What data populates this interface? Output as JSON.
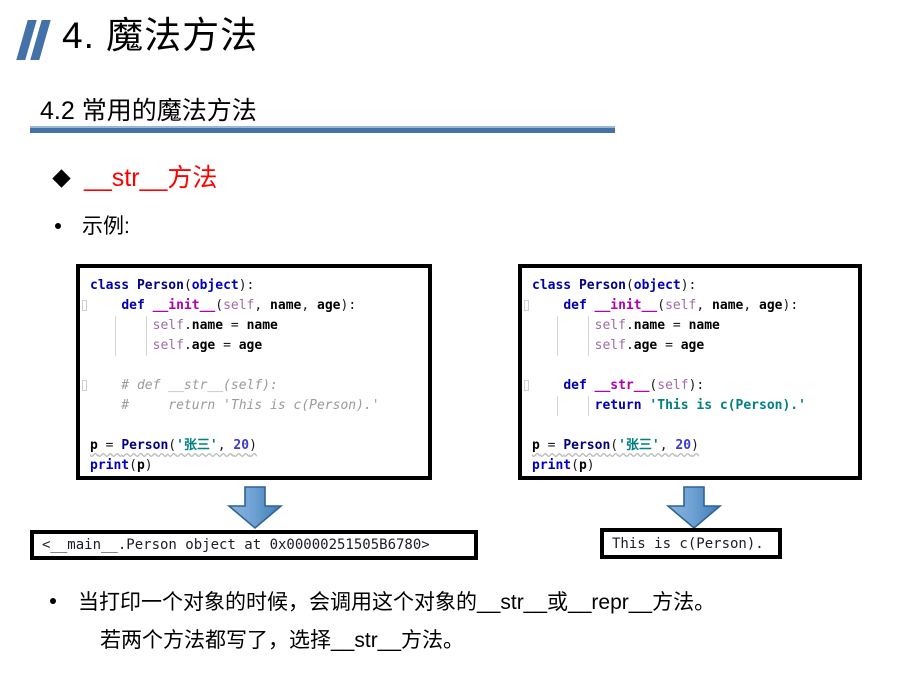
{
  "slide": {
    "title": "4.  魔法方法",
    "section_heading": "4.2  常用的魔法方法",
    "accent_color": "#4472a8",
    "highlight_color": "#ff0000"
  },
  "bullets": {
    "str_method": "__str__方法",
    "example_label": "示例:"
  },
  "icons": {
    "title_mark": "double-slash-mark",
    "diamond_bullet": "diamond-bullet-icon",
    "round_bullet": "round-bullet-icon",
    "arrow": "arrow-down-icon"
  },
  "code_left": {
    "lines": [
      [
        {
          "t": "class ",
          "c": "k"
        },
        {
          "t": "Person",
          "c": "cls"
        },
        {
          "t": "(",
          "c": "pl"
        },
        {
          "t": "object",
          "c": "bi"
        },
        {
          "t": "):",
          "c": "pl"
        }
      ],
      [
        {
          "t": "    ",
          "c": "pl"
        },
        {
          "t": "def ",
          "c": "k"
        },
        {
          "t": "__init__",
          "c": "fn"
        },
        {
          "t": "(",
          "c": "pl"
        },
        {
          "t": "self",
          "c": "slf"
        },
        {
          "t": ", ",
          "c": "pl"
        },
        {
          "t": "name",
          "c": "id"
        },
        {
          "t": ", ",
          "c": "pl"
        },
        {
          "t": "age",
          "c": "id"
        },
        {
          "t": "):",
          "c": "pl"
        }
      ],
      [
        {
          "t": "        ",
          "c": "pl"
        },
        {
          "t": "self",
          "c": "slf"
        },
        {
          "t": ".",
          "c": "pl"
        },
        {
          "t": "name",
          "c": "id"
        },
        {
          "t": " = ",
          "c": "pl"
        },
        {
          "t": "name",
          "c": "id"
        }
      ],
      [
        {
          "t": "        ",
          "c": "pl"
        },
        {
          "t": "self",
          "c": "slf"
        },
        {
          "t": ".",
          "c": "pl"
        },
        {
          "t": "age",
          "c": "id"
        },
        {
          "t": " = ",
          "c": "pl"
        },
        {
          "t": "age",
          "c": "id"
        }
      ],
      [],
      [
        {
          "t": "    # def __str__(self):",
          "c": "cm"
        }
      ],
      [
        {
          "t": "    #     return 'This is c(Person).'",
          "c": "cm"
        }
      ],
      [],
      [
        {
          "t": "p",
          "c": "id"
        },
        {
          "t": " = ",
          "c": "pl"
        },
        {
          "t": "Person",
          "c": "cls"
        },
        {
          "t": "(",
          "c": "pl"
        },
        {
          "t": "'张三'",
          "c": "st"
        },
        {
          "t": ", ",
          "c": "pl"
        },
        {
          "t": "20",
          "c": "nm"
        },
        {
          "t": ")",
          "c": "pl"
        }
      ],
      [
        {
          "t": "print",
          "c": "bi"
        },
        {
          "t": "(",
          "c": "pl"
        },
        {
          "t": "p",
          "c": "id"
        },
        {
          "t": ")",
          "c": "pl"
        }
      ]
    ]
  },
  "code_right": {
    "lines": [
      [
        {
          "t": "class ",
          "c": "k"
        },
        {
          "t": "Person",
          "c": "cls"
        },
        {
          "t": "(",
          "c": "pl"
        },
        {
          "t": "object",
          "c": "bi"
        },
        {
          "t": "):",
          "c": "pl"
        }
      ],
      [
        {
          "t": "    ",
          "c": "pl"
        },
        {
          "t": "def ",
          "c": "k"
        },
        {
          "t": "__init__",
          "c": "fn"
        },
        {
          "t": "(",
          "c": "pl"
        },
        {
          "t": "self",
          "c": "slf"
        },
        {
          "t": ", ",
          "c": "pl"
        },
        {
          "t": "name",
          "c": "id"
        },
        {
          "t": ", ",
          "c": "pl"
        },
        {
          "t": "age",
          "c": "id"
        },
        {
          "t": "):",
          "c": "pl"
        }
      ],
      [
        {
          "t": "        ",
          "c": "pl"
        },
        {
          "t": "self",
          "c": "slf"
        },
        {
          "t": ".",
          "c": "pl"
        },
        {
          "t": "name",
          "c": "id"
        },
        {
          "t": " = ",
          "c": "pl"
        },
        {
          "t": "name",
          "c": "id"
        }
      ],
      [
        {
          "t": "        ",
          "c": "pl"
        },
        {
          "t": "self",
          "c": "slf"
        },
        {
          "t": ".",
          "c": "pl"
        },
        {
          "t": "age",
          "c": "id"
        },
        {
          "t": " = ",
          "c": "pl"
        },
        {
          "t": "age",
          "c": "id"
        }
      ],
      [],
      [
        {
          "t": "    ",
          "c": "pl"
        },
        {
          "t": "def ",
          "c": "k"
        },
        {
          "t": "__str__",
          "c": "fn"
        },
        {
          "t": "(",
          "c": "pl"
        },
        {
          "t": "self",
          "c": "slf"
        },
        {
          "t": "):",
          "c": "pl"
        }
      ],
      [
        {
          "t": "        ",
          "c": "pl"
        },
        {
          "t": "return ",
          "c": "k"
        },
        {
          "t": "'This is c(Person).'",
          "c": "st"
        }
      ],
      [],
      [
        {
          "t": "p",
          "c": "id"
        },
        {
          "t": " = ",
          "c": "pl"
        },
        {
          "t": "Person",
          "c": "cls"
        },
        {
          "t": "(",
          "c": "pl"
        },
        {
          "t": "'张三'",
          "c": "st"
        },
        {
          "t": ", ",
          "c": "pl"
        },
        {
          "t": "20",
          "c": "nm"
        },
        {
          "t": ")",
          "c": "pl"
        }
      ],
      [
        {
          "t": "print",
          "c": "bi"
        },
        {
          "t": "(",
          "c": "pl"
        },
        {
          "t": "p",
          "c": "id"
        },
        {
          "t": ")",
          "c": "pl"
        }
      ]
    ]
  },
  "outputs": {
    "left": "<__main__.Person object at 0x00000251505B6780>",
    "right": "This is c(Person)."
  },
  "bottom_note": {
    "line1": "当打印一个对象的时候，会调用这个对象的__str__或__repr__方法。",
    "line2": "若两个方法都写了，选择__str__方法。"
  }
}
